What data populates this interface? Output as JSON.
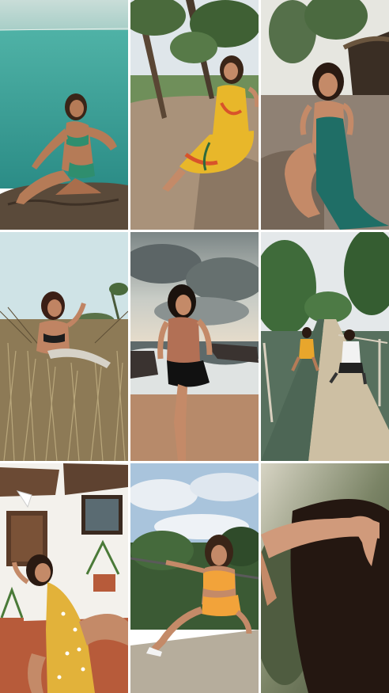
{
  "collage": {
    "layout": "3x3 photo grid",
    "tiles": [
      {
        "name": "photo-1",
        "scene": "sea-rock",
        "colors": {
          "sky": "#b9d6d0",
          "sea": "#3aa39a",
          "rock": "#5a4a3a",
          "outfit": "#2f8e6e",
          "skin": "#b57b57",
          "hair": "#3a2518"
        }
      },
      {
        "name": "photo-2",
        "scene": "trees-yellow-dress",
        "colors": {
          "sky": "#dfe6ea",
          "ground": "#a9927a",
          "outfit": "#e8b72a",
          "accent": "#d8532a",
          "skin": "#c48a68",
          "hair": "#3a2518"
        }
      },
      {
        "name": "photo-3",
        "scene": "hut-teal-dress",
        "colors": {
          "sky": "#e6e6e0",
          "ground": "#8f8174",
          "outfit": "#1f6e66",
          "skin": "#c48a68",
          "hair": "#2a1a12"
        }
      },
      {
        "name": "photo-4",
        "scene": "dry-grass",
        "colors": {
          "sky": "#cfe3e6",
          "grass": "#8d7a56",
          "outfit": "#1d1d1d",
          "skin": "#c08463",
          "hair": "#3b1f16"
        }
      },
      {
        "name": "photo-5",
        "scene": "beach-waves",
        "colors": {
          "sky": "#9ea8a7",
          "cloud": "#5c6566",
          "sea": "#dfe3e2",
          "sand": "#b78a6a",
          "outfit": "#111111",
          "top": "#b27055",
          "skin": "#c48a68",
          "hair": "#1b120d"
        }
      },
      {
        "name": "photo-6",
        "scene": "pier-river",
        "colors": {
          "sky": "#e4e8ea",
          "trees": "#3f6b3a",
          "water": "#57705e",
          "pier": "#cdbfa3",
          "outfit": "#e8a62c",
          "skin": "#b57b57"
        }
      },
      {
        "name": "photo-7",
        "scene": "white-house",
        "colors": {
          "wall": "#f3f1ec",
          "roof": "#6b4a34",
          "floor": "#b75b3a",
          "outfit": "#e2b23a",
          "skin": "#c48a68",
          "hair": "#2a1a12"
        }
      },
      {
        "name": "photo-8",
        "scene": "sky-railing",
        "colors": {
          "sky": "#a9c4dc",
          "cloud": "#e9eef3",
          "trees": "#3b5a34",
          "ground": "#b6ad9c",
          "outfit": "#f2a33a",
          "skin": "#c48a68",
          "hair": "#3a2518"
        }
      },
      {
        "name": "photo-9",
        "scene": "closeup-hands",
        "colors": {
          "bg": "#5e6b4e",
          "light": "#d7d4c4",
          "skin": "#d09a7b",
          "hair": "#241711"
        }
      }
    ]
  }
}
